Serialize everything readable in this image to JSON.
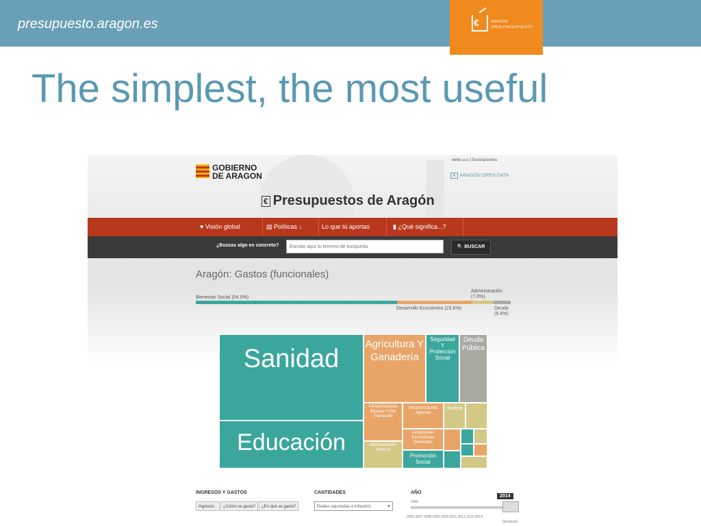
{
  "header": {
    "site_url": "presupuesto.aragon.es",
    "orange_logo": {
      "line1": "ARAGÓN",
      "line2": "OPEN PRESUPUESTO",
      "icon": "euro-box-icon"
    },
    "aod_logo": {
      "letter": "A",
      "bold": "ARAGÓN",
      "rest": " OPEN DATA"
    }
  },
  "slide_title": "The simplest, the most useful",
  "screenshot": {
    "gobierno": {
      "line1": "GOBIERNO",
      "line2": "DE ARAGON"
    },
    "top_links": "webs a-z | Suscripciones",
    "mini_aod": {
      "letter": "A",
      "text": "ARAGÓN OPEN DATA"
    },
    "site_title": "Presupuestos de Aragón",
    "site_title_icon": "€",
    "nav": [
      {
        "label": "♥ Visión global",
        "icon": "globe-icon"
      },
      {
        "label": "▤ Políticas ↓",
        "icon": "list-icon"
      },
      {
        "label": "Lo que tú aportas",
        "icon": ""
      },
      {
        "label": "▮ ¿Qué significa...?",
        "icon": "book-icon"
      }
    ],
    "search": {
      "label": "¿Buscas algo en concreto?",
      "placeholder": "Escribe aquí tu término de búsqueda",
      "button": "🔍 BUSCAR"
    },
    "chart_title": "Aragón: Gastos (funcionales)",
    "summary_labels": {
      "bienestar": "Bienestar Social (64.0%)",
      "desarrollo": "Desarrollo Económico (23.6%)",
      "administracion": "Administración (7.0%)",
      "deuda": "Deuda (5.4%)"
    },
    "colors": {
      "teal": "#3ba79c",
      "orange": "#e9a468",
      "gray": "#a9a9a2",
      "olive": "#d3c886",
      "nav_red": "#b8381e",
      "header_blue": "#6a9fb8",
      "accent_orange": "#f08a1e"
    },
    "treemap": {
      "sanidad": "Sanidad",
      "educacion": "Educación",
      "agricultura": "Agricultura Y Ganadería",
      "seguridad": "Seguridad Y Protección Social",
      "deuda": "Deuda Pública",
      "infra_basicas": "Infraestructuras Básicas Y Del Transporte",
      "infra_agrarias": "Infraestructuras Agrarias",
      "justicia": "Justicia",
      "admin_general": "Administración General",
      "actuaciones": "Actuaciones Económicas Generales",
      "promocion": "Promoción Social"
    },
    "controls": {
      "ingresos_gastos_heading": "INGRESOS Y GASTOS",
      "btn_ingresos": "Ingresos",
      "btn_como": "¿Cómo se gasta?",
      "btn_en_que": "¿En qué se gasta?",
      "cantidades_heading": "CANTIDADES",
      "cantidades_value": "Reales (ajustadas a inflación)",
      "anio_heading": "AÑO",
      "year_selected": "2014",
      "year_start": "2006",
      "years": "2006  2007  2008  2009  2010  2011  2012  2013 2014",
      "proyecto": "(proyecto)"
    }
  },
  "summary_bar_shares": {
    "bienestar": 64.0,
    "desarrollo": 23.6,
    "administracion": 7.0,
    "deuda": 5.4
  }
}
